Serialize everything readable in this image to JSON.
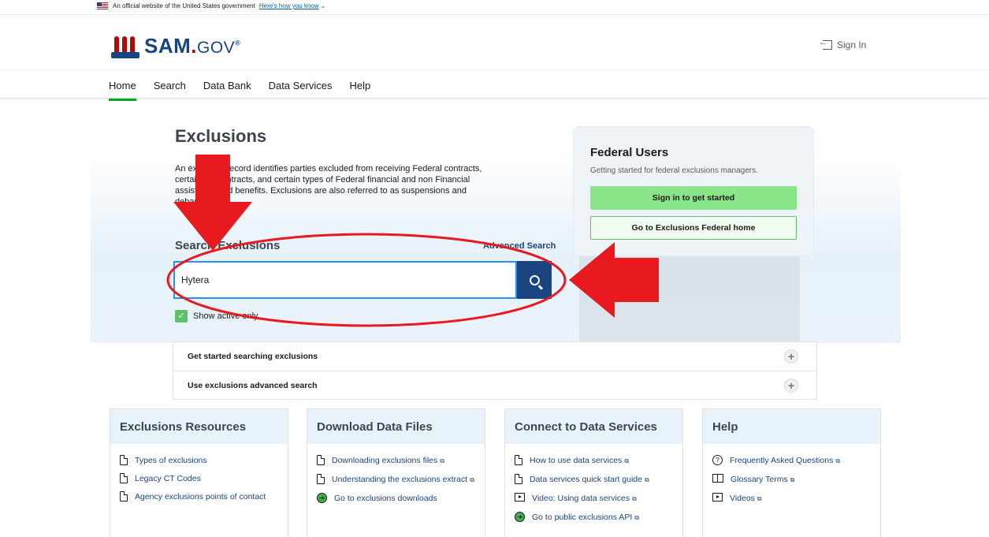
{
  "gov_banner": {
    "text": "An official website of the United States government",
    "link": "Here's how you know"
  },
  "header": {
    "logo": {
      "sam": "SAM",
      "dot": ".",
      "gov": "GOV",
      "reg": "®"
    },
    "sign_in": "Sign In"
  },
  "nav": {
    "items": [
      "Home",
      "Search",
      "Data Bank",
      "Data Services",
      "Help"
    ]
  },
  "exclusions": {
    "title": "Exclusions",
    "description": "An exclusion record identifies parties excluded from receiving Federal contracts, certain subcontracts, and certain types of Federal financial and non Financial assistance and benefits. Exclusions are also referred to as suspensions and debarments.",
    "search_title": "Search Exclusions",
    "advanced_search": "Advanced Search",
    "search_value": "Hytera",
    "show_active_only": "Show active only"
  },
  "federal_users": {
    "title": "Federal Users",
    "subtitle": "Getting started for federal exclusions managers.",
    "sign_in_button": "Sign in to get started",
    "home_button": "Go to Exclusions Federal home"
  },
  "accordion": [
    "Get started searching exclusions",
    "Use exclusions advanced search"
  ],
  "cards": {
    "resources": {
      "title": "Exclusions Resources",
      "items": [
        "Types of exclusions",
        "Legacy CT Codes",
        "Agency exclusions points of contact"
      ]
    },
    "download": {
      "title": "Download Data Files",
      "items": [
        "Downloading exclusions files",
        "Understanding the exclusions extract",
        "Go to exclusions downloads"
      ]
    },
    "connect": {
      "title": "Connect to Data Services",
      "items": [
        "How to use data services",
        "Data services quick start guide",
        "Video: Using data services",
        "Go to public exclusions API"
      ]
    },
    "help": {
      "title": "Help",
      "items": [
        "Frequently Asked Questions",
        "Glossary Terms",
        "Videos"
      ]
    }
  },
  "colors": {
    "brand_blue": "#1a4480",
    "brand_red": "#b50909",
    "accent_green": "#00a91c",
    "annotation_red": "#e8191f"
  }
}
